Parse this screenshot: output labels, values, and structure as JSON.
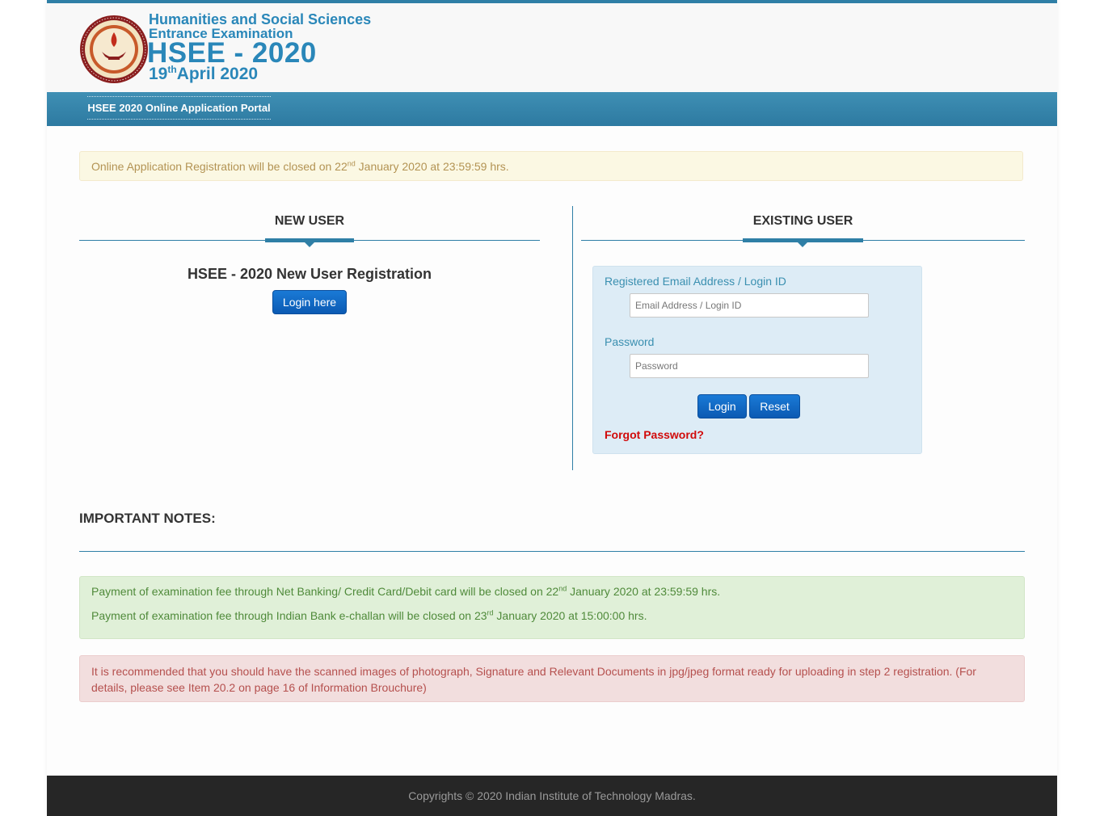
{
  "header": {
    "logo_line1": "Humanities and Social Sciences",
    "logo_line2": "Entrance Examination",
    "logo_title": "HSEE - 2020",
    "logo_date_day": "19",
    "logo_date_sup": "th",
    "logo_date_rest": "April 2020"
  },
  "nav": {
    "items": [
      "HSEE 2020 Online Application Portal"
    ]
  },
  "notice": {
    "prefix": "Online Application Registration will be closed on 22",
    "sup": "nd",
    "suffix": " January 2020 at 23:59:59 hrs."
  },
  "new_user": {
    "section_title": "NEW USER",
    "heading": "HSEE - 2020 New User Registration",
    "button_label": "Login here"
  },
  "existing_user": {
    "section_title": "EXISTING USER",
    "email_label": "Registered Email Address / Login ID",
    "email_placeholder": "Email Address / Login ID",
    "email_value": "",
    "password_label": "Password",
    "password_placeholder": "Password",
    "password_value": "",
    "login_label": "Login",
    "reset_label": "Reset",
    "forgot_label": "Forgot Password?"
  },
  "notes": {
    "title": "IMPORTANT NOTES:",
    "payment1_prefix": "Payment of examination fee through Net Banking/ Credit Card/Debit card will be closed on 22",
    "payment1_sup": "nd",
    "payment1_suffix": " January 2020 at 23:59:59 hrs.",
    "payment2_prefix": "Payment of examination fee through Indian Bank e-challan will be closed on 23",
    "payment2_sup": "rd",
    "payment2_suffix": " January 2020 at 15:00:00 hrs.",
    "recommendation": "It is recommended that you should have the scanned images of photograph, Signature and Relevant Documents in jpg/jpeg format ready for uploading in step 2 registration. (For details, please see Item 20.2 on page 16 of Information Brouchure)"
  },
  "footer": {
    "copyright": "Copyrights © 2020 Indian Institute of Technology Madras."
  },
  "colors": {
    "accent": "#2f7fa6",
    "button": "#0b5ab3",
    "warning_text": "#b39353",
    "success_text": "#4f8a3a",
    "danger_text": "#b5504e",
    "forgot_red": "#d10a0a"
  }
}
